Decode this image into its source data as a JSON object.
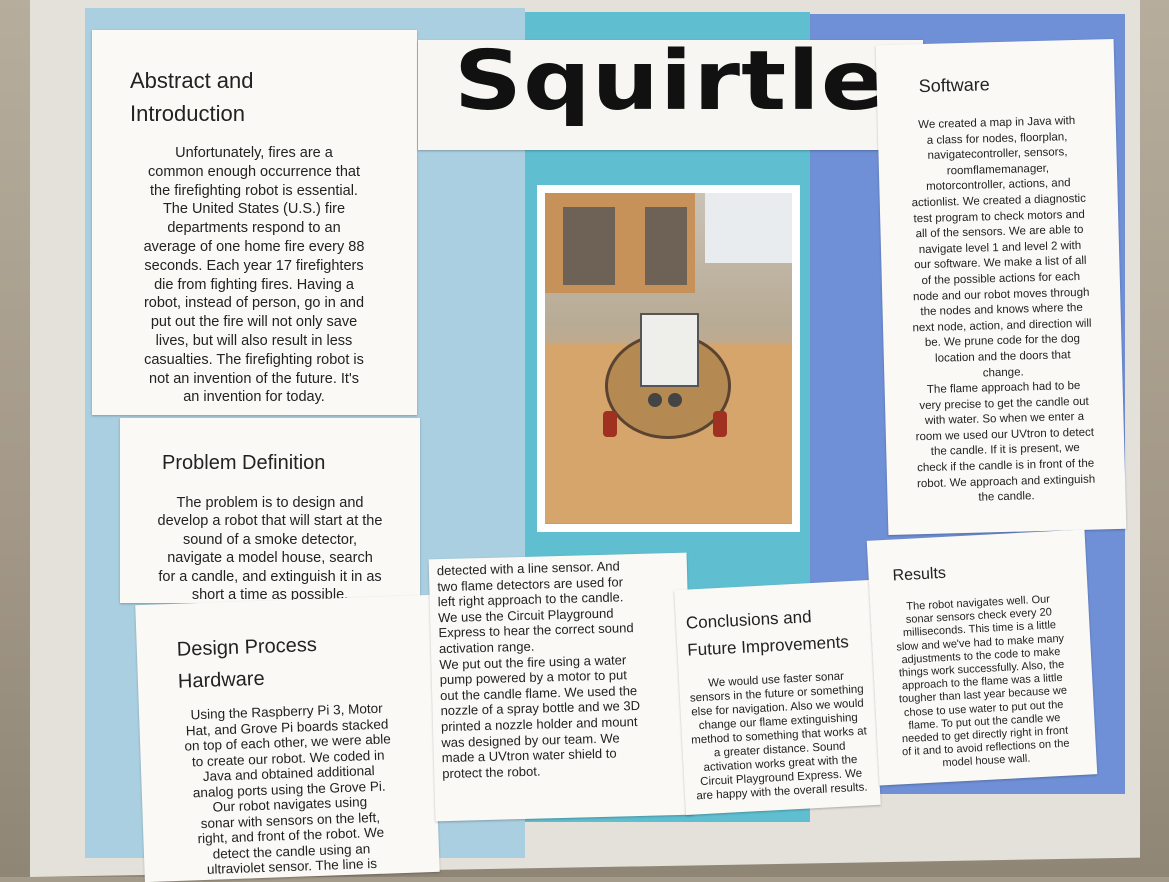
{
  "poster": {
    "title": "Squirtle",
    "abstract": {
      "heading_line1": "Abstract and",
      "heading_line2": "Introduction",
      "lines": [
        "Unfortunately, fires are a",
        "common enough occurrence that",
        "the firefighting robot is essential.",
        "The United States (U.S.) fire",
        "departments respond to an",
        "average of one home fire every 88",
        "seconds. Each year 17 firefighters",
        "die from fighting fires. Having a",
        "robot, instead of person, go in and",
        "put out the fire will not only save",
        "lives, but will also result in less",
        "casualties. The firefighting robot is",
        "not an invention of the future. It's",
        "an invention for today."
      ]
    },
    "problem": {
      "heading": "Problem Definition",
      "lines": [
        "The problem is to design and",
        "develop a robot that will start at the",
        "sound of a smoke detector,",
        "navigate a model house, search",
        "for a candle, and extinguish it in as",
        "short a time as possible."
      ]
    },
    "design": {
      "heading_line1": "Design Process",
      "heading_line2": "Hardware",
      "lines": [
        "Using the Raspberry Pi 3, Motor",
        "Hat, and Grove Pi boards stacked",
        "on top of each other, we were able",
        "to create our robot. We coded in",
        "Java and obtained additional",
        "analog ports using the Grove Pi.",
        "Our robot navigates  using",
        "sonar with sensors on the left,",
        "right, and front of the robot. We",
        "detect the candle using an",
        "ultraviolet sensor. The line is"
      ]
    },
    "design_cont": {
      "lines": [
        "detected with a line sensor. And",
        "two flame detectors are used for",
        "left right approach to the candle.",
        "We use the Circuit Playground",
        "Express to hear the correct sound",
        "activation range.",
        "We put out the fire using a water",
        "pump powered by a motor to put",
        "out the candle flame. We used the",
        "nozzle of a spray bottle and we 3D",
        "printed a nozzle holder and mount",
        "was designed by our team. We",
        "made a UVtron water shield to",
        "protect the robot."
      ]
    },
    "conclusions": {
      "heading_line1": "Conclusions and",
      "heading_line2": "Future Improvements",
      "lines": [
        "We would use faster sonar",
        "sensors in the future or something",
        "else for navigation. Also we would",
        "change our flame extinguishing",
        "method to something that works at",
        "a greater distance. Sound",
        "activation works great with the",
        "Circuit Playground Express. We",
        "are happy with the overall results."
      ]
    },
    "software": {
      "heading": "Software",
      "lines": [
        "We created a map in Java with",
        "a class for nodes, floorplan,",
        "navigatecontroller, sensors,",
        "roomflamemanager,",
        "motorcontroller, actions, and",
        "actionlist. We created a diagnostic",
        "test program to check motors and",
        "all of the sensors. We are able to",
        "navigate level 1 and level 2 with",
        "our software. We make a list of all",
        "of the possible actions for each",
        "node and our robot moves through",
        "the nodes and knows where the",
        "next node, action, and direction will",
        "be. We prune code for the dog",
        "location and the doors that",
        "change.",
        "The flame approach had to be",
        "very precise to get the candle out",
        "with water. So when we enter a",
        "room we used our UVtron to detect",
        "the candle. If it is present, we",
        "check if the candle is in front of the",
        "robot. We approach and extinguish",
        "the candle."
      ]
    },
    "results": {
      "heading": "Results",
      "lines": [
        "The robot navigates well. Our",
        "sonar sensors check every 20",
        "milliseconds. This time is a little",
        "slow and we've had to make many",
        "adjustments to the code to make",
        "things work successfully. Also, the",
        "approach to the flame was a little",
        "tougher than last year because we",
        "chose to use water to put out the",
        "flame. To put out the candle we",
        "needed to get directly right in front",
        "of it and to avoid reflections on the",
        "model house wall."
      ]
    }
  },
  "colors": {
    "light_blue": "#a9cfe0",
    "turquoise": "#5fbfd0",
    "periwinkle": "#6f8fd6",
    "paper": "#faf9f6"
  }
}
